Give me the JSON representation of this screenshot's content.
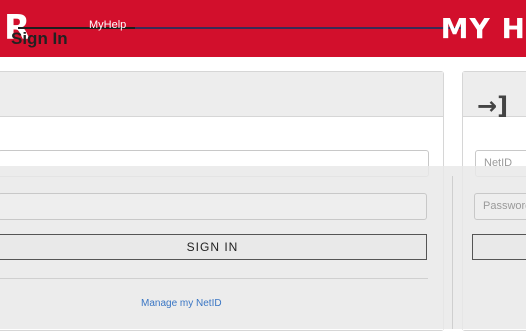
{
  "header": {
    "logo_letter": "R",
    "title": "MyHelp",
    "brand": "MY H"
  },
  "signin_card": {
    "title": "Sign In",
    "netid_placeholder": "",
    "password_placeholder": "",
    "button_label": "SIGN IN",
    "manage_link": "Manage my NetID"
  },
  "right_card": {
    "icon": "sign-in-arrow-icon",
    "netid_placeholder": "NetID",
    "password_placeholder": "Password"
  },
  "colors": {
    "brand_red": "#d20f2c",
    "link_blue": "#3a76c4"
  }
}
